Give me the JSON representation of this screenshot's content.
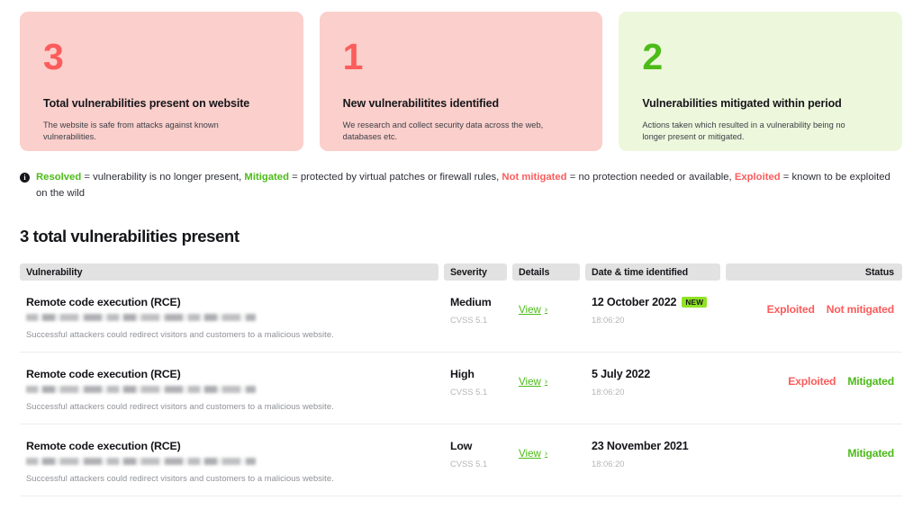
{
  "cards": [
    {
      "number": "3",
      "title": "Total vulnerabilities present on website",
      "desc": "The website is safe from attacks against known vulnerabilities.",
      "tone": "red"
    },
    {
      "number": "1",
      "title": "New vulnerabilitites identified",
      "desc": "We research and collect security data across the web, databases etc.",
      "tone": "red"
    },
    {
      "number": "2",
      "title": "Vulnerabilities mitigated within period",
      "desc": "Actions taken which resulted in a vulnerability being no longer present or mitigated.",
      "tone": "green"
    }
  ],
  "legend": {
    "icon": "info-icon",
    "icon_glyph": "i",
    "resolved_label": "Resolved",
    "resolved_def": " = vulnerability is no longer present, ",
    "mitigated_label": "Mitigated",
    "mitigated_def": " =  protected by virtual patches or firewall rules, ",
    "not_mitigated_label": "Not mitigated",
    "not_mitigated_def": " = no protection needed or available, ",
    "exploited_label": "Exploited",
    "exploited_def": " = known to be exploited on the wild"
  },
  "section": {
    "title": "3 total vulnerabilities present"
  },
  "table": {
    "headers": {
      "vulnerability": "Vulnerability",
      "severity": "Severity",
      "details": "Details",
      "date": "Date & time identified",
      "status": "Status"
    },
    "rows": [
      {
        "title": "Remote code execution (RCE)",
        "redacted": "",
        "desc": "Successful attackers could redirect visitors and customers to a malicious website.",
        "severity": "Medium",
        "cvss": "CVSS 5.1",
        "details_link": "View",
        "chevron": "›",
        "date": "12 October 2022",
        "badge": "NEW",
        "time": "18:06:20",
        "status_a": "Exploited",
        "status_a_tone": "red",
        "status_b": "Not mitigated",
        "status_b_tone": "red"
      },
      {
        "title": "Remote code execution (RCE)",
        "redacted": "",
        "desc": "Successful attackers could redirect visitors and customers to a malicious website.",
        "severity": "High",
        "cvss": "CVSS 5.1",
        "details_link": "View",
        "chevron": "›",
        "date": "5 July 2022",
        "badge": "",
        "time": "18:06:20",
        "status_a": "Exploited",
        "status_a_tone": "red",
        "status_b": "Mitigated",
        "status_b_tone": "green"
      },
      {
        "title": "Remote code execution (RCE)",
        "redacted": "",
        "desc": "Successful attackers could redirect visitors and customers to a malicious website.",
        "severity": "Low",
        "cvss": "CVSS 5.1",
        "details_link": "View",
        "chevron": "›",
        "date": "23 November 2021",
        "badge": "",
        "time": "18:06:20",
        "status_a": "",
        "status_a_tone": "red",
        "status_b": "Mitigated",
        "status_b_tone": "green"
      }
    ]
  },
  "colors": {
    "red_accent": "#fb5c5c",
    "green_accent": "#4cbb17",
    "card_red_bg": "#fbcfcb",
    "card_green_bg": "#edf7dc",
    "badge_new_bg": "#8fe324",
    "header_bg": "#e2e2e2"
  }
}
